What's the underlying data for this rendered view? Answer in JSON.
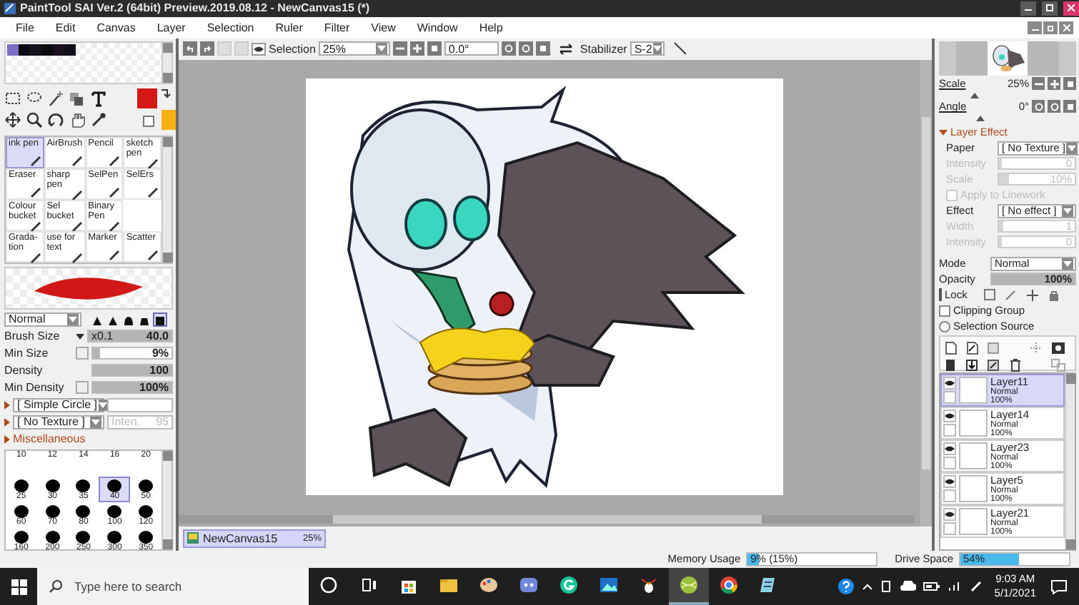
{
  "window": {
    "title": "PaintTool SAI Ver.2 (64bit) Preview.2019.08.12 - NewCanvas15 (*)"
  },
  "menu": [
    "File",
    "Edit",
    "Canvas",
    "Layer",
    "Selection",
    "Ruler",
    "Filter",
    "View",
    "Window",
    "Help"
  ],
  "toolbar": {
    "selection_label": "Selection",
    "zoom": "25%",
    "angle": "0.0°",
    "stabilizer_label": "Stabilizer",
    "stabilizer": "S-2"
  },
  "swatches": [
    {
      "color": "#7b6fc4"
    },
    {
      "color": "#0a0a14"
    },
    {
      "color": "#14101c"
    },
    {
      "color": "#0c0c10"
    },
    {
      "color": "#1a1020"
    },
    {
      "color": "#10101a"
    }
  ],
  "colors": [
    {
      "kind": "foreground",
      "color": "#d41818"
    },
    {
      "kind": "background",
      "color": "#f8b012"
    }
  ],
  "tools": [
    {
      "kind": "tool",
      "label": "ink pen",
      "selected": true
    },
    {
      "kind": "tool",
      "label": "AirBrush",
      "selected": false
    },
    {
      "kind": "tool",
      "label": "Pencil",
      "selected": false
    },
    {
      "kind": "tool",
      "label": "sketch pen",
      "selected": false
    },
    {
      "kind": "tool",
      "label": "Eraser",
      "selected": false
    },
    {
      "kind": "tool",
      "label": "sharp pen",
      "selected": false
    },
    {
      "kind": "tool",
      "label": "SelPen",
      "selected": false
    },
    {
      "kind": "tool",
      "label": "SelErs",
      "selected": false
    },
    {
      "kind": "tool",
      "label": "Colour bucket",
      "selected": false
    },
    {
      "kind": "tool",
      "label": "Sel bucket",
      "selected": false
    },
    {
      "kind": "tool",
      "label": "Binary Pen",
      "selected": false
    },
    {
      "kind": "empty"
    },
    {
      "kind": "tool",
      "label": "Grada-tion",
      "selected": false
    },
    {
      "kind": "tool",
      "label": "use for text",
      "selected": false
    },
    {
      "kind": "tool",
      "label": "Marker",
      "selected": false
    },
    {
      "kind": "tool",
      "label": "Scatter",
      "selected": false
    }
  ],
  "brush": {
    "blend_mode": "Normal",
    "tips": [
      {
        "kind": "cone",
        "selected": false
      },
      {
        "kind": "cone",
        "selected": false
      },
      {
        "kind": "dome",
        "selected": false
      },
      {
        "kind": "flat",
        "selected": false
      },
      {
        "kind": "square",
        "selected": true
      }
    ],
    "params": [
      {
        "label": "Brush Size",
        "multiplier": "x0.1",
        "reading": "40.0",
        "level": 1
      },
      {
        "label": "Min Size",
        "reading": "9%",
        "level": 0.09
      },
      {
        "label": "Density",
        "reading": "100",
        "level": 1
      },
      {
        "label": "Min Density",
        "reading": "100%",
        "level": 1
      }
    ],
    "shape": "[ Simple Circle ]",
    "texture": "[ No Texture ]",
    "texture_intensity": {
      "label": "Inten.",
      "reading": "95"
    },
    "misc": "Miscellaneous"
  },
  "brush_sizes": {
    "cut_row": [
      "10",
      "12",
      "14",
      "16",
      "20"
    ],
    "items": [
      {
        "label": "25",
        "selected": false
      },
      {
        "label": "30",
        "selected": false
      },
      {
        "label": "35",
        "selected": false
      },
      {
        "label": "40",
        "selected": true
      },
      {
        "label": "50",
        "selected": false
      },
      {
        "label": "60",
        "selected": false
      },
      {
        "label": "70",
        "selected": false
      },
      {
        "label": "80",
        "selected": false
      },
      {
        "label": "100",
        "selected": false
      },
      {
        "label": "120",
        "selected": false
      },
      {
        "label": "160",
        "selected": false
      },
      {
        "label": "200",
        "selected": false
      },
      {
        "label": "250",
        "selected": false
      },
      {
        "label": "300",
        "selected": false
      },
      {
        "label": "350",
        "selected": false
      }
    ]
  },
  "navigator": {
    "scale_label": "Scale",
    "scale": "25%",
    "angle_label": "Angle",
    "angle": "0°"
  },
  "layer_effect": {
    "title": "Layer Effect",
    "expanded": true,
    "fields": [
      {
        "kind": "dropdown",
        "label": "Paper",
        "value": "[ No Texture ]"
      },
      {
        "kind": "slider",
        "label": "Intensity",
        "value": "0",
        "disabled": true,
        "level": 0
      },
      {
        "kind": "slider",
        "label": "Scale",
        "value": "10%",
        "disabled": true,
        "level": 0.1
      },
      {
        "kind": "checkbox",
        "label": "Apply to Linework",
        "disabled": true,
        "checked": false
      },
      {
        "kind": "dropdown",
        "label": "Effect",
        "value": "[ No effect ]"
      },
      {
        "kind": "slider",
        "label": "Width",
        "value": "1",
        "disabled": true,
        "level": 0.02
      },
      {
        "kind": "slider",
        "label": "Intensity",
        "value": "0",
        "disabled": true,
        "level": 0
      }
    ]
  },
  "layer_props": {
    "mode_label": "Mode",
    "mode": "Normal",
    "opacity": {
      "label": "Opacity",
      "reading": "100%",
      "level": 1
    },
    "lock_label": "Lock",
    "clipping_group": {
      "label": "Clipping Group",
      "checked": false
    },
    "selection_source": {
      "label": "Selection Source",
      "checked": false
    }
  },
  "layers": [
    {
      "name": "Layer11",
      "mode": "Normal",
      "opacity": "100%",
      "visible": true,
      "selected": true
    },
    {
      "name": "Layer14",
      "mode": "Normal",
      "opacity": "100%",
      "visible": true,
      "selected": false
    },
    {
      "name": "Layer23",
      "mode": "Normal",
      "opacity": "100%",
      "visible": true,
      "selected": false
    },
    {
      "name": "Layer5",
      "mode": "Normal",
      "opacity": "100%",
      "visible": true,
      "selected": false
    },
    {
      "name": "Layer21",
      "mode": "Normal",
      "opacity": "100%",
      "visible": true,
      "selected": false
    }
  ],
  "canvas_tabs": [
    {
      "name": "NewCanvas15",
      "zoom": "25%",
      "selected": true
    }
  ],
  "status": {
    "memory": {
      "label": "Memory Usage",
      "reading": "9% (15%)",
      "level": 0.09
    },
    "drive": {
      "label": "Drive Space",
      "reading": "54%",
      "level": 0.54
    }
  },
  "taskbar": {
    "search": {
      "placeholder": "Type here to search"
    },
    "apps": [
      {
        "kind": "cortana",
        "selected": false
      },
      {
        "kind": "taskview",
        "selected": false
      },
      {
        "kind": "store",
        "selected": false
      },
      {
        "kind": "explorer",
        "selected": false
      },
      {
        "kind": "paint",
        "selected": false
      },
      {
        "kind": "discord",
        "selected": false
      },
      {
        "kind": "grammarly",
        "selected": false
      },
      {
        "kind": "photos",
        "selected": false
      },
      {
        "kind": "penguin",
        "selected": false
      },
      {
        "kind": "ball",
        "selected": true
      },
      {
        "kind": "chrome",
        "selected": false
      },
      {
        "kind": "notes",
        "selected": false
      }
    ],
    "time": "9:03 AM",
    "date": "5/1/2021"
  }
}
